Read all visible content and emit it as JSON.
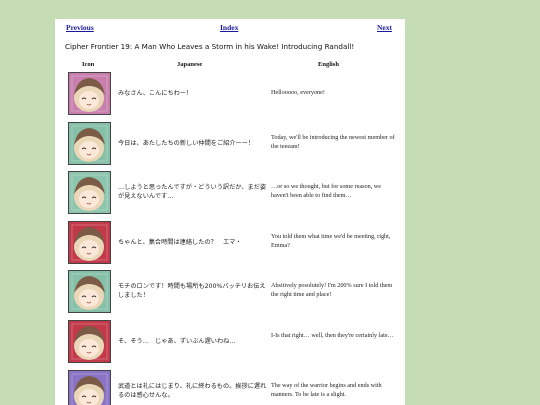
{
  "nav": {
    "previous": "Previous",
    "index": "Index",
    "next": "Next"
  },
  "title": "Cipher Frontier 19: A Man Who Leaves a Storm in his Wake! Introducing Randall!",
  "columns": {
    "icon": "Icon",
    "japanese": "Japanese",
    "english": "English"
  },
  "rows": [
    {
      "jp": "みなさん、こんにちわー！",
      "en": "Hellooooo, everyone!",
      "icon": "pair-chibi-icon",
      "bg": "#c97fae"
    },
    {
      "jp": "今日は、あたしたちの新しい仲間をご紹介ーー！",
      "en": "Today, we'll be introducing the newest member of the teeeam!",
      "icon": "happy-chibi-icon",
      "bg": "#86c0a8"
    },
    {
      "jp": "…しようと思ったんですが・どういう訳だか、まだ姿が見えないんです…",
      "en": "…or so we thought, but for some reason, we haven't been able to find them…",
      "icon": "worried-chibi-icon",
      "bg": "#8cc4ad"
    },
    {
      "jp": "ちゃんと、集合時間は連絡したの？　エマ・",
      "en": "You told them what time we'd be meeting, right, Emma?",
      "icon": "silver-hair-chibi-icon",
      "bg": "#c23a4a"
    },
    {
      "jp": "モチのロンです！時間も場所も200%バッチリお伝えしました！",
      "en": "Absitively posolutely! I'm 200% sure I told them the right time and place!",
      "icon": "cheerful-chibi-icon",
      "bg": "#86c0a8"
    },
    {
      "jp": "そ、そう…　じゃあ、ずいぶん遅いわね…",
      "en": "I-Is that right… well, then they're certainly late…",
      "icon": "puzzled-chibi-icon",
      "bg": "#c23a4a"
    },
    {
      "jp": "武道とは礼にはじまり、礼に終わるもの。挨拶に遅れるのは感心せんな。",
      "en": "The way of the warrior begins and ends with manners. To be late is a slight.",
      "icon": "warrior-chibi-icon",
      "bg": "#8a72c4"
    }
  ]
}
